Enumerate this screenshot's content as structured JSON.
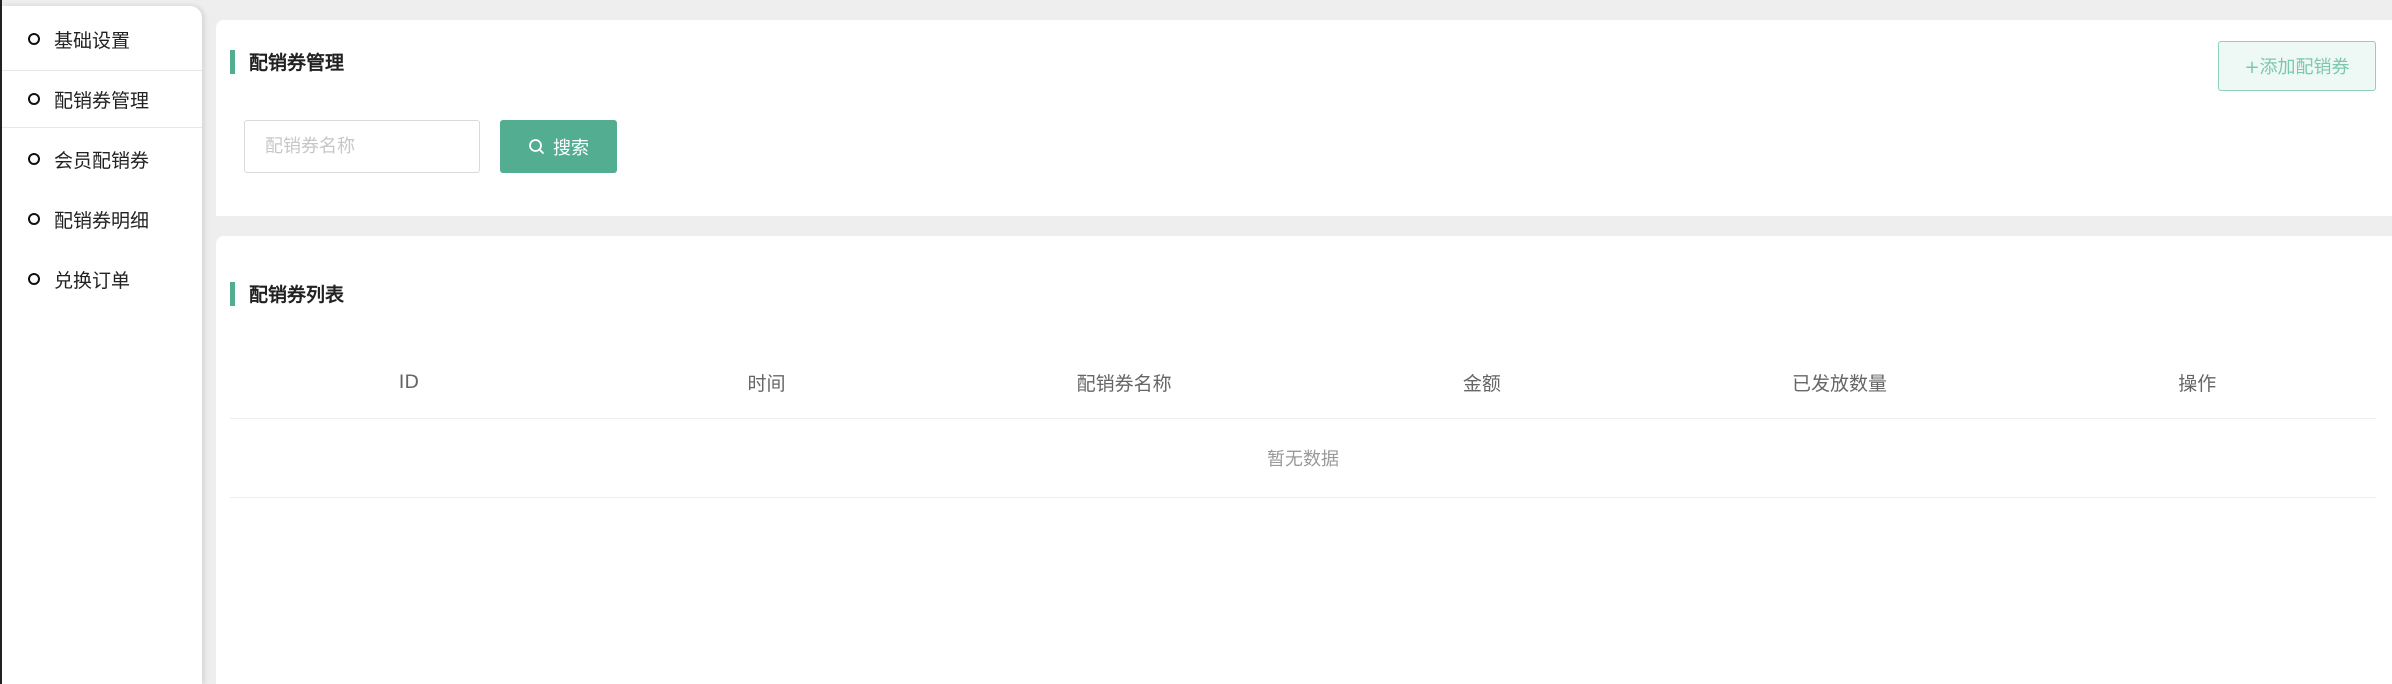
{
  "sidebar": {
    "items": [
      {
        "label": "基础设置",
        "active": false
      },
      {
        "label": "配销券管理",
        "active": true
      },
      {
        "label": "会员配销券",
        "active": false
      },
      {
        "label": "配销券明细",
        "active": false
      },
      {
        "label": "兑换订单",
        "active": false
      }
    ]
  },
  "manage_section": {
    "title": "配销券管理",
    "add_button": "+添加配销券",
    "search": {
      "placeholder": "配销券名称",
      "value": "",
      "button_label": "搜索",
      "button_icon": "search-icon"
    }
  },
  "list_section": {
    "title": "配销券列表",
    "columns": [
      "ID",
      "时间",
      "配销券名称",
      "金额",
      "已发放数量",
      "操作"
    ],
    "rows": [],
    "empty_text": "暂无数据"
  },
  "colors": {
    "accent": "#52ad91",
    "add_button_border": "#8fd1bd",
    "add_button_text": "#7cc7b0"
  }
}
